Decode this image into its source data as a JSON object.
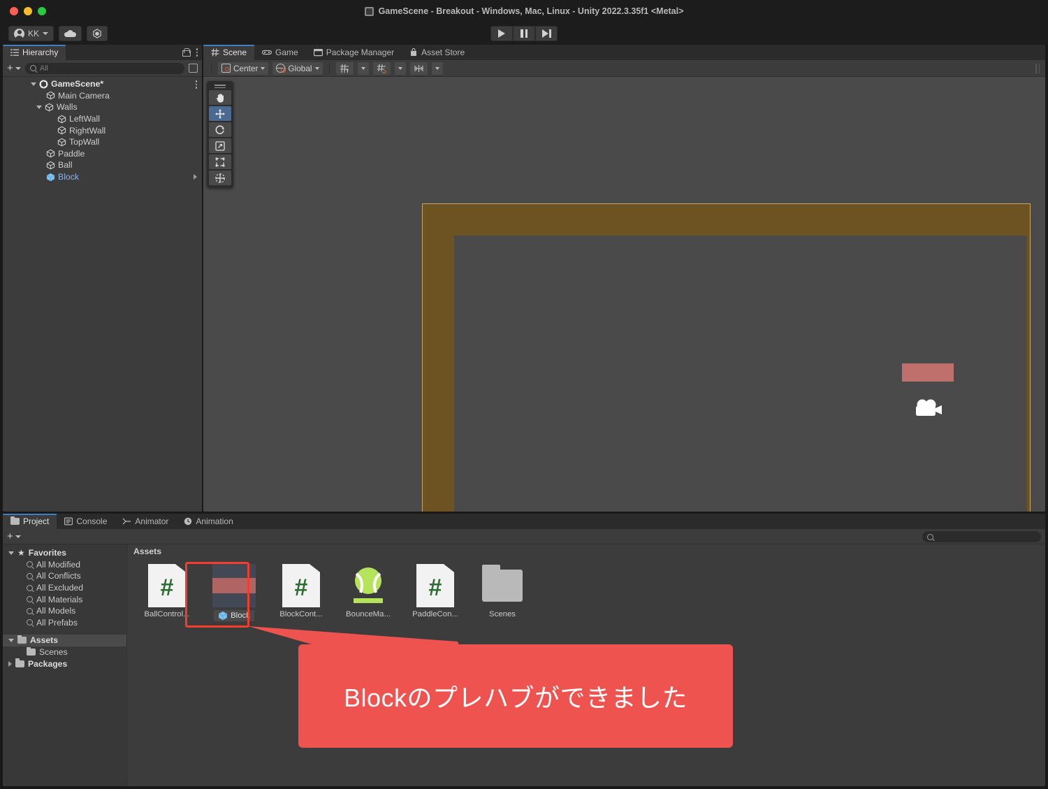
{
  "window": {
    "title": "GameScene - Breakout - Windows, Mac, Linux - Unity 2022.3.35f1 <Metal>",
    "scene_icon": "scene-file-icon"
  },
  "toolbar": {
    "account_label": "KK",
    "account_icon": "account-avatar-icon",
    "cloud_icon": "cloud-icon",
    "services_icon": "unity-services-icon",
    "play_icon": "play-icon",
    "pause_icon": "pause-icon",
    "step_icon": "step-icon"
  },
  "hierarchy": {
    "tab_label": "Hierarchy",
    "tab_icon": "hierarchy-icon",
    "lock_icon": "lock-icon",
    "menu_icon": "kebab-menu-icon",
    "add_label": "+",
    "search_placeholder": "All",
    "search_value": "",
    "search_icon": "search-icon",
    "view_icon": "view-options-icon",
    "items": [
      {
        "label": "GameScene*",
        "depth": 0,
        "expanded": true,
        "icon": "unity-scene-icon",
        "selected": false
      },
      {
        "label": "Main Camera",
        "depth": 1,
        "expanded": null,
        "icon": "gameobject-cube-icon",
        "selected": false
      },
      {
        "label": "Walls",
        "depth": 1,
        "expanded": true,
        "icon": "gameobject-cube-icon",
        "selected": false
      },
      {
        "label": "LeftWall",
        "depth": 2,
        "expanded": null,
        "icon": "gameobject-cube-icon",
        "selected": false
      },
      {
        "label": "RightWall",
        "depth": 2,
        "expanded": null,
        "icon": "gameobject-cube-icon",
        "selected": false
      },
      {
        "label": "TopWall",
        "depth": 2,
        "expanded": null,
        "icon": "gameobject-cube-icon",
        "selected": false
      },
      {
        "label": "Paddle",
        "depth": 1,
        "expanded": null,
        "icon": "gameobject-cube-icon",
        "selected": false
      },
      {
        "label": "Ball",
        "depth": 1,
        "expanded": null,
        "icon": "gameobject-cube-icon",
        "selected": false
      },
      {
        "label": "Block",
        "depth": 1,
        "expanded": null,
        "icon": "prefab-cube-icon",
        "selected": true
      }
    ]
  },
  "scene": {
    "tabs": [
      {
        "label": "Scene",
        "icon": "grid-icon",
        "active": true
      },
      {
        "label": "Game",
        "icon": "gamepad-icon",
        "active": false
      },
      {
        "label": "Package Manager",
        "icon": "package-icon",
        "active": false
      },
      {
        "label": "Asset Store",
        "icon": "store-bag-icon",
        "active": false
      }
    ],
    "toolbar": {
      "pivot_label": "Center",
      "pivot_icon": "pivot-center-icon",
      "handle_label": "Global",
      "handle_icon": "globe-icon",
      "grid_snap_icon": "grid-snapping-icon",
      "grid_visibility_icon": "grid-visibility-icon",
      "layout_icon": "component-layout-icon",
      "dropdown_icon": "chevron-down-icon"
    },
    "tools": [
      {
        "name": "hand-tool",
        "icon": "hand-icon",
        "active": false
      },
      {
        "name": "move-tool",
        "icon": "move-icon",
        "active": true
      },
      {
        "name": "rotate-tool",
        "icon": "rotate-icon",
        "active": false
      },
      {
        "name": "scale-tool",
        "icon": "scale-icon",
        "active": false
      },
      {
        "name": "rect-tool",
        "icon": "rect-transform-icon",
        "active": false
      },
      {
        "name": "transform-tool",
        "icon": "transform-icon",
        "active": false
      }
    ],
    "objects": {
      "wall_color": "#6e5322",
      "wall_outline_color": "#c6a868",
      "block_color": "#c0706c",
      "ball_color": "#ffffff",
      "paddle_color": "#ffffff",
      "background_color": "#4a4a4a",
      "camera_gizmo_icon": "camera-gizmo-icon"
    }
  },
  "project": {
    "tabs": [
      {
        "label": "Project",
        "icon": "folder-icon",
        "active": true
      },
      {
        "label": "Console",
        "icon": "console-icon",
        "active": false
      },
      {
        "label": "Animator",
        "icon": "animator-icon",
        "active": false
      },
      {
        "label": "Animation",
        "icon": "animation-clock-icon",
        "active": false
      }
    ],
    "add_label": "+",
    "search_placeholder": "",
    "search_value": "",
    "search_icon": "search-icon",
    "breadcrumb": "Assets",
    "tree": [
      {
        "label": "Favorites",
        "depth": 0,
        "kind": "star",
        "expanded": true,
        "highlight": false
      },
      {
        "label": "All Modified",
        "depth": 1,
        "kind": "search",
        "expanded": null,
        "highlight": false
      },
      {
        "label": "All Conflicts",
        "depth": 1,
        "kind": "search",
        "expanded": null,
        "highlight": false
      },
      {
        "label": "All Excluded",
        "depth": 1,
        "kind": "search",
        "expanded": null,
        "highlight": false
      },
      {
        "label": "All Materials",
        "depth": 1,
        "kind": "search",
        "expanded": null,
        "highlight": false
      },
      {
        "label": "All Models",
        "depth": 1,
        "kind": "search",
        "expanded": null,
        "highlight": false
      },
      {
        "label": "All Prefabs",
        "depth": 1,
        "kind": "search",
        "expanded": null,
        "highlight": false
      },
      {
        "label": "Assets",
        "depth": 0,
        "kind": "folder-open",
        "expanded": true,
        "highlight": true
      },
      {
        "label": "Scenes",
        "depth": 1,
        "kind": "folder",
        "expanded": null,
        "highlight": false
      },
      {
        "label": "Packages",
        "depth": 0,
        "kind": "folder",
        "expanded": false,
        "highlight": false
      }
    ],
    "assets": [
      {
        "label": "BallControl...",
        "kind": "csharp",
        "selected": false
      },
      {
        "label": "Block",
        "kind": "prefab",
        "selected": true,
        "badge_icon": "prefab-cube-icon"
      },
      {
        "label": "BlockCont...",
        "kind": "csharp",
        "selected": false
      },
      {
        "label": "BounceMa...",
        "kind": "material",
        "selected": false
      },
      {
        "label": "PaddleCon...",
        "kind": "csharp",
        "selected": false
      },
      {
        "label": "Scenes",
        "kind": "folder",
        "selected": false
      }
    ]
  },
  "callout": {
    "text": "Blockのプレハブができました",
    "background_color": "#ef5350",
    "text_color": "#ffffff",
    "highlight_border_color": "#f23c2e"
  }
}
